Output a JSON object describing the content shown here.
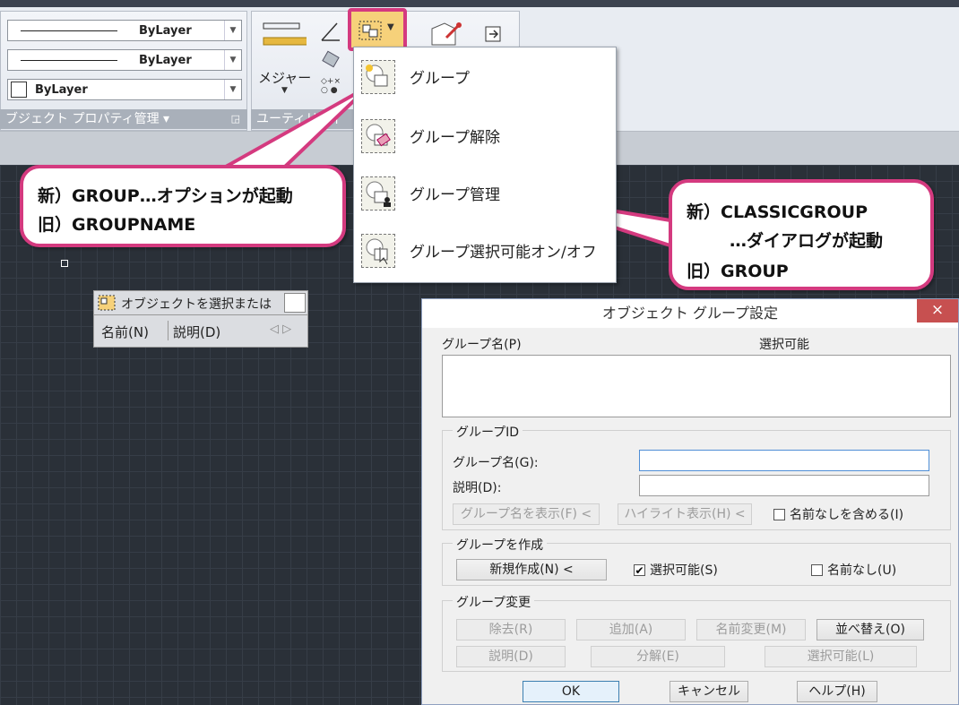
{
  "ribbon": {
    "linetype1": "ByLayer",
    "linetype2": "ByLayer",
    "color": "ByLayer",
    "props_panel_title": "ブジェクト プロパティ管理 ▾",
    "measure_label": "メジャー",
    "util_panel_title": "ユーティリティ"
  },
  "menu": {
    "items": [
      "グループ",
      "グループ解除",
      "グループ管理",
      "グループ選択可能オン/オフ"
    ]
  },
  "callout_left": {
    "line1": "新）GROUP…オプションが起動",
    "line2": "旧）GROUPNAME"
  },
  "callout_right": {
    "line1": "新）CLASSICGROUP",
    "line2": "…ダイアログが起動",
    "line3": "旧）GROUP"
  },
  "cmd_prompt": {
    "text": "オブジェクトを選択または",
    "col_name": "名前(N)",
    "col_desc": "説明(D)"
  },
  "dialog": {
    "title": "オブジェクト グループ設定",
    "close": "×",
    "list_header_name": "グループ名(P)",
    "list_header_selectable": "選択可能",
    "group_id_label": "グループID",
    "group_name_label": "グループ名(G):",
    "desc_label": "説明(D):",
    "btn_find_name": "グループ名を表示(F) <",
    "btn_highlight": "ハイライト表示(H) <",
    "include_unnamed": "名前なしを含める(I)",
    "create_label": "グループを作成",
    "btn_new": "新規作成(N) <",
    "selectable": "選択可能(S)",
    "unnamed": "名前なし(U)",
    "change_label": "グループ変更",
    "btn_remove": "除去(R)",
    "btn_add": "追加(A)",
    "btn_rename": "名前変更(M)",
    "btn_reorder": "並べ替え(O)",
    "btn_desc": "説明(D)",
    "btn_explode": "分解(E)",
    "btn_selectable": "選択可能(L)",
    "btn_ok": "OK",
    "btn_cancel": "キャンセル",
    "btn_help": "ヘルプ(H)"
  },
  "colors": {
    "highlight": "#d43a7f",
    "canvas": "#2a3038"
  }
}
